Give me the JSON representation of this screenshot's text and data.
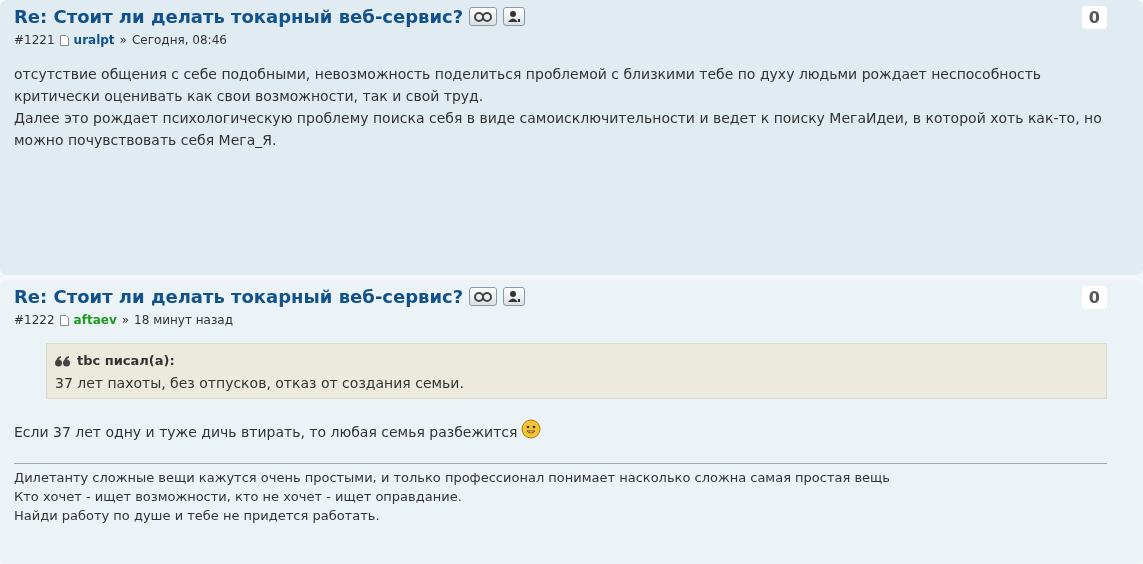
{
  "posts": [
    {
      "title": "Re: Стоит ли делать токарный веб-сервис?",
      "number": "#1221",
      "author": "uralpt",
      "color": "#105289",
      "separator": "»",
      "time": "Сегодня, 08:46",
      "score": "0",
      "tall": true,
      "paragraphs": [
        "отсутствие общения с себе подобными, невозможность поделиться проблемой с близкими тебе по духу людьми рождает неспособность критически оценивать как свои возможности, так и свой труд.",
        "Далее это рождает психологическую проблему поиска себя в виде самоисключительности и ведет к поиску МегаИдеи, в которой хоть как-то, но можно почувствовать себя Мега_Я."
      ],
      "smiley": false
    },
    {
      "title": "Re: Стоит ли делать токарный веб-сервис?",
      "number": "#1222",
      "author": "aftaev",
      "color": "#1c9a1c",
      "separator": "»",
      "time": "18 минут назад",
      "score": "0",
      "tall": false,
      "quote": {
        "cite": "tbc писал(а):",
        "text": "37 лет пахоты, без отпусков, отказ от создания семьи."
      },
      "paragraphs": [
        "Если 37 лет одну и туже дичь втирать, то любая семья разбежится"
      ],
      "smiley": true,
      "signature": [
        "Дилетанту сложные вещи кажутся очень простыми, и только профессионал понимает насколько сложна самая простая вещь",
        "Кто хочет - ищет возможности, кто не хочет - ищет оправдание.",
        "Найди работу по душе и тебе не придется работать."
      ]
    }
  ]
}
